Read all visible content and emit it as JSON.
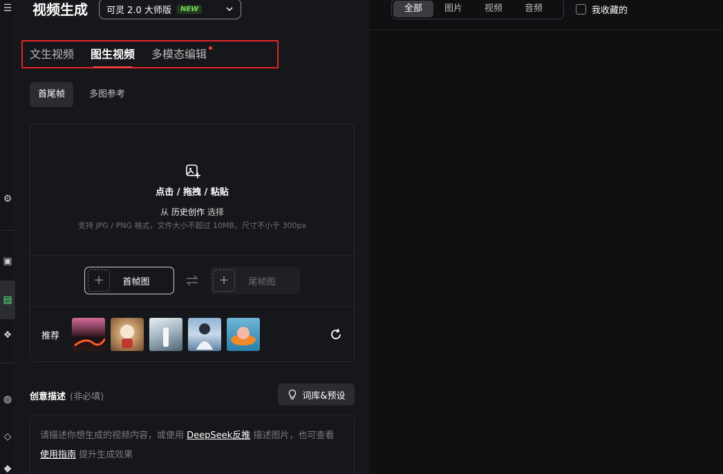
{
  "header": {
    "title": "视频生成",
    "model": {
      "name": "可灵 2.0 大师版",
      "badge": "NEW"
    }
  },
  "mode_tabs": [
    {
      "label": "文生视频",
      "active": false
    },
    {
      "label": "图生视频",
      "active": true
    },
    {
      "label": "多模态编辑",
      "active": false,
      "dot": true
    }
  ],
  "sub_tabs": [
    {
      "label": "首尾帧",
      "active": true
    },
    {
      "label": "多图参考",
      "active": false
    }
  ],
  "upload": {
    "main_text": "点击 / 拖拽 / 粘贴",
    "history_prefix": "从",
    "history_link": "历史创作",
    "history_suffix": "选择",
    "hint": "支持 JPG / PNG 格式，文件大小不超过 10MB，尺寸不小于 300px",
    "first_frame_label": "首帧图",
    "last_frame_label": "尾帧图"
  },
  "recommend": {
    "label": "推荐",
    "thumbs": [
      {
        "icon": "lava-landscape-thumb"
      },
      {
        "icon": "fluffy-animal-thumb"
      },
      {
        "icon": "snowy-figure-thumb"
      },
      {
        "icon": "anime-character-thumb"
      },
      {
        "icon": "pig-float-thumb"
      }
    ]
  },
  "description": {
    "title": "创意描述",
    "optional": "(非必填)",
    "lexicon_button": "词库&预设",
    "prompt_part1": "请描述你想生成的视频内容，或使用",
    "prompt_link1": "DeepSeek反推",
    "prompt_part2": "描述图片，也可查看",
    "prompt_link2": "使用指南",
    "prompt_part3": "提升生成效果"
  },
  "right": {
    "filters": [
      {
        "label": "全部",
        "active": true
      },
      {
        "label": "图片",
        "active": false
      },
      {
        "label": "视频",
        "active": false
      },
      {
        "label": "音频",
        "active": false
      }
    ],
    "favorites_label": "我收藏的"
  },
  "colors": {
    "accent_red": "#e5252a",
    "new_badge": "#7bdc5a",
    "background": "#16171a"
  }
}
